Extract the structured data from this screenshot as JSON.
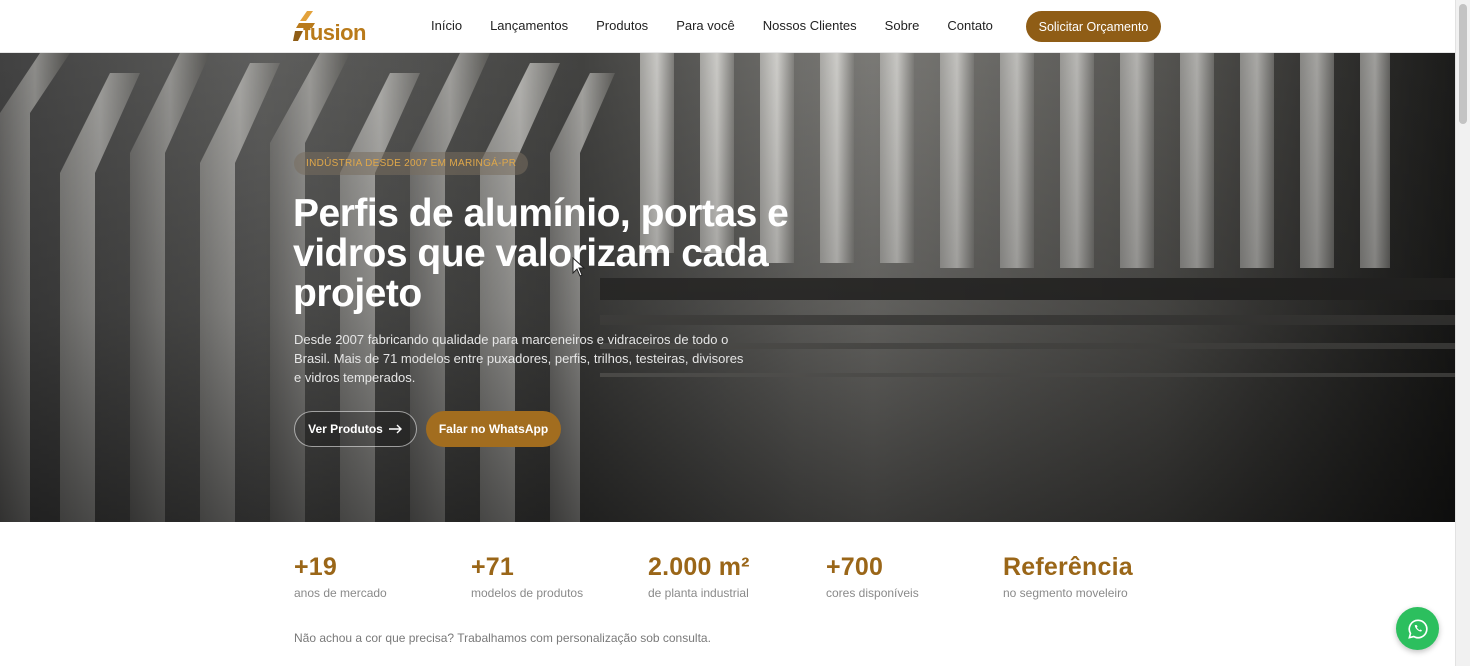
{
  "brand": {
    "name": "fusion",
    "color": "#b97a1a"
  },
  "nav": {
    "items": [
      "Início",
      "Lançamentos",
      "Produtos",
      "Para você",
      "Nossos Clientes",
      "Sobre",
      "Contato"
    ],
    "cta": "Solicitar Orçamento"
  },
  "hero": {
    "badge": "INDÚSTRIA DESDE 2007 EM MARINGÁ-PR",
    "title": "Perfis de alumínio, portas e vidros que valorizam cada projeto",
    "description": "Desde 2007 fabricando qualidade para marceneiros e vidraceiros de todo o Brasil. Mais de 71 modelos entre puxadores, perfis, trilhos, testeiras, divisores e vidros temperados.",
    "primary_button": "Ver Produtos",
    "primary_button_icon": "arrow-right-icon",
    "secondary_button": "Falar no WhatsApp"
  },
  "stats": [
    {
      "value": "+19",
      "label": "anos de mercado"
    },
    {
      "value": "+71",
      "label": "modelos de produtos"
    },
    {
      "value": "2.000 m²",
      "label": "de planta industrial"
    },
    {
      "value": "+700",
      "label": "cores disponíveis"
    },
    {
      "value": "Referência",
      "label": "no segmento moveleiro"
    }
  ],
  "note": "Não achou a cor que precisa? Trabalhamos com personalização sob consulta.",
  "floating": {
    "icon": "whatsapp-icon",
    "color": "#2cbf5e"
  },
  "colors": {
    "accent": "#8f5d16",
    "stat": "#9a6618"
  }
}
